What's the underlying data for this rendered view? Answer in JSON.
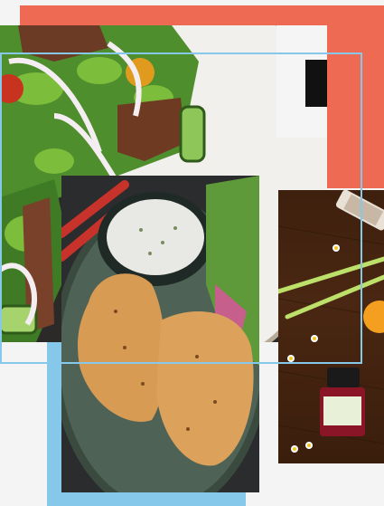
{
  "colors": {
    "accent_orange": "#ee6a52",
    "accent_blue": "#86c8ea",
    "background": "#f4f4f4"
  },
  "photos": [
    {
      "subject": "steak-salad-plate"
    },
    {
      "subject": "essential-oil-and-herbs"
    },
    {
      "subject": "grilled-chicken-with-dip"
    }
  ]
}
